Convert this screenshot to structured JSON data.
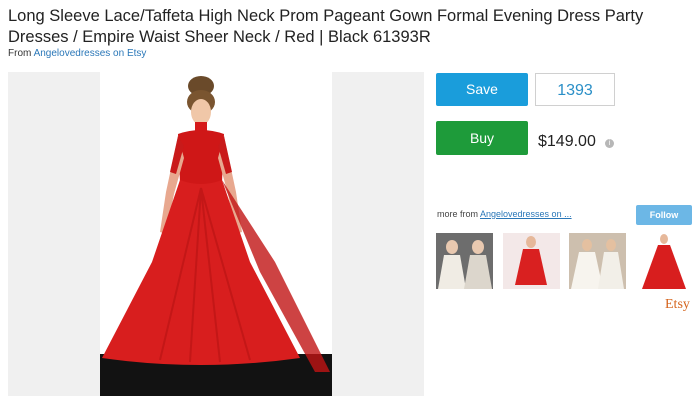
{
  "listing": {
    "title": "Long Sleeve Lace/Taffeta High Neck Prom Pageant Gown Formal Evening Dress Party Dresses / Empire Waist Sheer Neck / Red | Black 61393R",
    "from_prefix": "From ",
    "shop_name": "Angelovedresses on Etsy"
  },
  "actions": {
    "save_label": "Save",
    "save_count": "1393",
    "buy_label": "Buy",
    "price": "$149.00",
    "info_icon": "i"
  },
  "more": {
    "prefix": "more from ",
    "shop_link": "Angelovedresses on ...",
    "follow_label": "Follow"
  },
  "brand": {
    "logo_text": "Etsy"
  },
  "colors": {
    "save": "#1a9ddb",
    "buy": "#1e9b3a",
    "link": "#2a77b8",
    "follow": "#6cb7e6",
    "dress": "#d81e1e",
    "etsy": "#d5641c"
  },
  "icons": [
    "info-icon"
  ]
}
